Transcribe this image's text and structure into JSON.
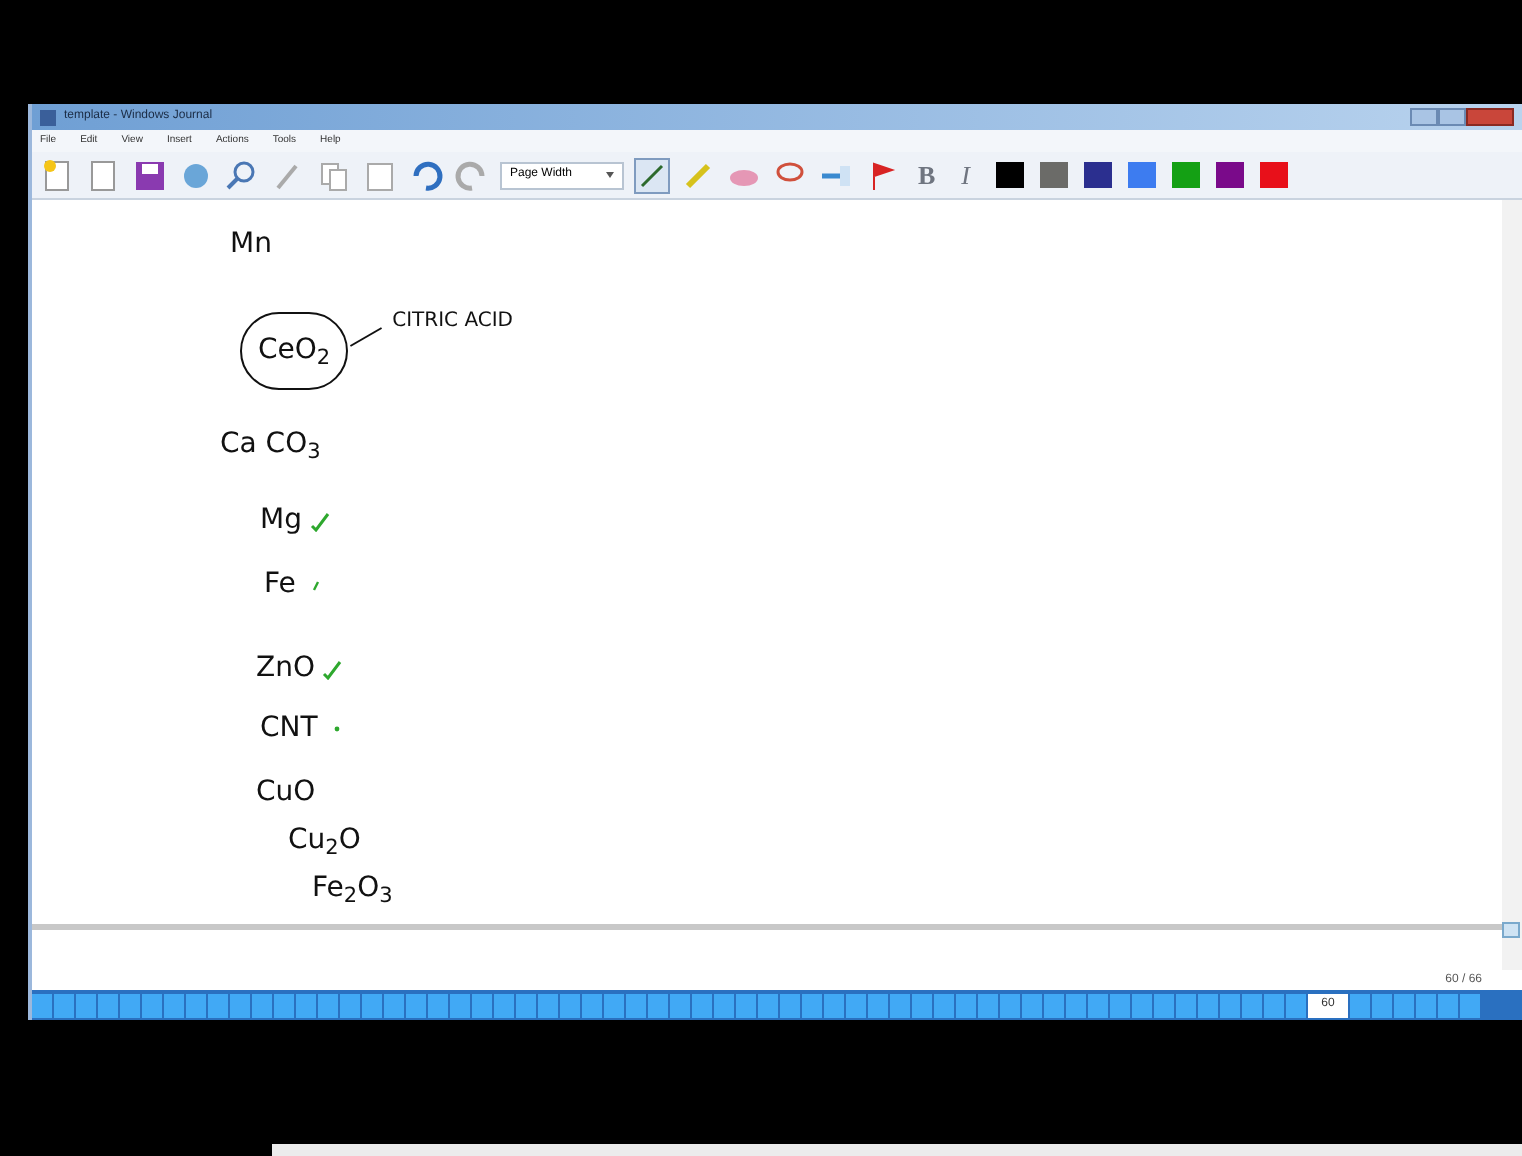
{
  "window": {
    "title": "template - Windows Journal"
  },
  "menu": [
    "File",
    "Edit",
    "View",
    "Insert",
    "Actions",
    "Tools",
    "Help"
  ],
  "toolbar": {
    "zoom": "Page Width",
    "bold": "B",
    "italic": "I"
  },
  "palette": [
    {
      "color": "#000000",
      "selected": false
    },
    {
      "color": "#6b6b68",
      "selected": false
    },
    {
      "color": "#2b2f8f",
      "selected": false
    },
    {
      "color": "#3d7cf0",
      "selected": false
    },
    {
      "color": "#14a014",
      "selected": false
    },
    {
      "color": "#7a0a8a",
      "selected": false
    },
    {
      "color": "#e8101a",
      "selected": false
    }
  ],
  "notes": [
    {
      "text": "Mn",
      "circled": false
    },
    {
      "text": "CeO$_{2}$",
      "circled": true,
      "annotation": "CITRIC ACID"
    },
    {
      "text": "Ca CO$_{3}$",
      "circled": false
    },
    {
      "text": "Mg",
      "circled": false,
      "kind": "check"
    },
    {
      "text": "Fe",
      "circled": false,
      "kind": "tick"
    },
    {
      "text": "ZnO",
      "circled": false,
      "kind": "check"
    },
    {
      "text": "CNT",
      "circled": false,
      "kind": "dot"
    },
    {
      "text": "CuO",
      "circled": false
    },
    {
      "text": "Cu$_{2}$O",
      "circled": false
    },
    {
      "text": "Fe$_{2}$O$_{3}$",
      "circled": false
    }
  ],
  "page_counter": "60 / 66",
  "page_bar": {
    "current": "60"
  }
}
